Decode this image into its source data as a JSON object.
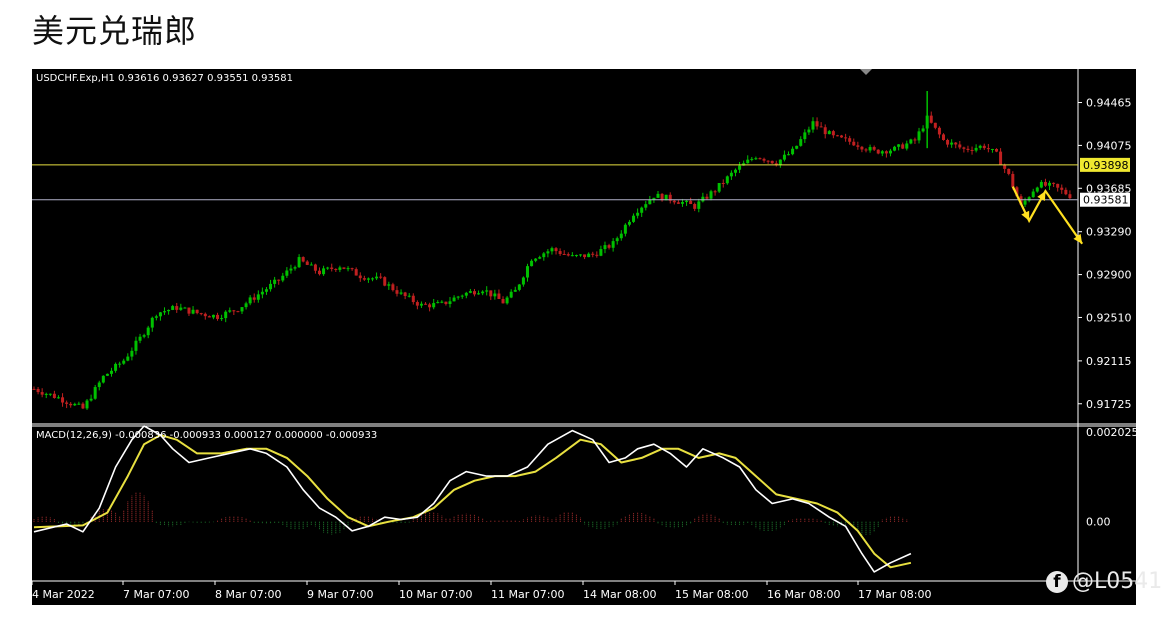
{
  "page_title": "美元兑瑞郎",
  "colors": {
    "background": "#000000",
    "bull_candle": "#00c000",
    "bear_candle": "#c02020",
    "macd_line": "#ffffff",
    "signal_line": "#e8e040",
    "hist_pos": "#b03030",
    "hist_neg": "#208030",
    "horizontal_line_1": "#e8e040",
    "horizontal_line_2": "#b0b0c8",
    "arrow": "#ffe020"
  },
  "watermark": {
    "icon": "facebook-icon",
    "text": "@L0541"
  },
  "chart_data": {
    "type": "candlestick",
    "symbol_header": "USDCHF.Exp,H1  0.93616 0.93627 0.93551 0.93581",
    "price_axis": {
      "ticks": [
        "0.94465",
        "0.94075",
        "0.93685",
        "0.93290",
        "0.92900",
        "0.92510",
        "0.92115",
        "0.91725"
      ],
      "ylim": [
        0.9155,
        0.9477
      ]
    },
    "price_labels": [
      {
        "label": "0.93898",
        "value": 0.93898,
        "style": "yellow"
      },
      {
        "label": "0.93581",
        "value": 0.93581,
        "style": "white"
      }
    ],
    "x_labels": [
      "4 Mar 2022",
      "7 Mar 07:00",
      "8 Mar 07:00",
      "9 Mar 07:00",
      "10 Mar 07:00",
      "11 Mar 07:00",
      "14 Mar 08:00",
      "15 Mar 08:00",
      "16 Mar 08:00",
      "17 Mar 08:00"
    ],
    "close_path": [
      [
        0,
        0.9186
      ],
      [
        6,
        0.9178
      ],
      [
        12,
        0.9168
      ],
      [
        17,
        0.9197
      ],
      [
        22,
        0.9212
      ],
      [
        26,
        0.9232
      ],
      [
        30,
        0.9255
      ],
      [
        35,
        0.926
      ],
      [
        40,
        0.9255
      ],
      [
        45,
        0.9252
      ],
      [
        50,
        0.9259
      ],
      [
        55,
        0.9272
      ],
      [
        60,
        0.9285
      ],
      [
        65,
        0.9303
      ],
      [
        70,
        0.9292
      ],
      [
        75,
        0.9298
      ],
      [
        80,
        0.9289
      ],
      [
        85,
        0.9285
      ],
      [
        90,
        0.9272
      ],
      [
        95,
        0.9262
      ],
      [
        100,
        0.9263
      ],
      [
        105,
        0.9272
      ],
      [
        110,
        0.9277
      ],
      [
        115,
        0.9265
      ],
      [
        118,
        0.9275
      ],
      [
        122,
        0.9305
      ],
      [
        127,
        0.9313
      ],
      [
        132,
        0.9306
      ],
      [
        137,
        0.9308
      ],
      [
        142,
        0.9318
      ],
      [
        147,
        0.9346
      ],
      [
        152,
        0.9362
      ],
      [
        157,
        0.9358
      ],
      [
        162,
        0.9352
      ],
      [
        167,
        0.9367
      ],
      [
        172,
        0.9385
      ],
      [
        177,
        0.9398
      ],
      [
        182,
        0.9392
      ],
      [
        186,
        0.9402
      ],
      [
        191,
        0.9428
      ],
      [
        196,
        0.9415
      ],
      [
        201,
        0.941
      ],
      [
        206,
        0.9402
      ],
      [
        211,
        0.9404
      ],
      [
        216,
        0.9412
      ],
      [
        219,
        0.9432
      ],
      [
        223,
        0.9412
      ],
      [
        228,
        0.9404
      ],
      [
        233,
        0.9407
      ],
      [
        236,
        0.9399
      ],
      [
        239,
        0.938
      ],
      [
        242,
        0.9352
      ],
      [
        246,
        0.9372
      ],
      [
        250,
        0.937
      ],
      [
        254,
        0.9362
      ]
    ],
    "macd_header": "MACD(12,26,9) -0.000836 -0.000933 0.000127 0.000000 -0.000933",
    "macd_axis": {
      "ticks": [
        "0.002025",
        "0.00"
      ],
      "ylim": [
        -0.0013,
        0.0021
      ]
    },
    "macd_line": [
      [
        0,
        -0.00022
      ],
      [
        8,
        -5e-05
      ],
      [
        12,
        -0.00022
      ],
      [
        16,
        0.0003
      ],
      [
        20,
        0.0012
      ],
      [
        24,
        0.0018
      ],
      [
        27,
        0.0021
      ],
      [
        31,
        0.0019
      ],
      [
        34,
        0.0016
      ],
      [
        38,
        0.0013
      ],
      [
        43,
        0.0014
      ],
      [
        48,
        0.0015
      ],
      [
        53,
        0.0016
      ],
      [
        57,
        0.0015
      ],
      [
        62,
        0.0012
      ],
      [
        66,
        0.0007
      ],
      [
        70,
        0.0003
      ],
      [
        74,
        0.0001
      ],
      [
        78,
        -0.0002
      ],
      [
        82,
        -0.0001
      ],
      [
        86,
        0.0001
      ],
      [
        90,
        5e-05
      ],
      [
        94,
        0.0001
      ],
      [
        98,
        0.0004
      ],
      [
        102,
        0.0009
      ],
      [
        106,
        0.0011
      ],
      [
        111,
        0.001
      ],
      [
        116,
        0.001
      ],
      [
        121,
        0.0012
      ],
      [
        126,
        0.0017
      ],
      [
        132,
        0.002
      ],
      [
        137,
        0.0018
      ],
      [
        141,
        0.0013
      ],
      [
        145,
        0.0014
      ],
      [
        148,
        0.0016
      ],
      [
        152,
        0.0017
      ],
      [
        156,
        0.0015
      ],
      [
        160,
        0.0012
      ],
      [
        164,
        0.0016
      ],
      [
        169,
        0.0014
      ],
      [
        173,
        0.0012
      ],
      [
        177,
        0.0007
      ],
      [
        181,
        0.0004
      ],
      [
        186,
        0.0005
      ],
      [
        190,
        0.0004
      ],
      [
        195,
        0.0001
      ],
      [
        199,
        -0.0001
      ],
      [
        203,
        -0.0007
      ],
      [
        206,
        -0.0011
      ],
      [
        210,
        -0.0009
      ],
      [
        215,
        -0.0007
      ]
    ],
    "signal_line": [
      [
        0,
        -0.00012
      ],
      [
        12,
        -8e-05
      ],
      [
        18,
        0.0002
      ],
      [
        23,
        0.001
      ],
      [
        27,
        0.0017
      ],
      [
        31,
        0.0019
      ],
      [
        35,
        0.0018
      ],
      [
        40,
        0.0015
      ],
      [
        46,
        0.0015
      ],
      [
        52,
        0.0016
      ],
      [
        57,
        0.0016
      ],
      [
        62,
        0.0014
      ],
      [
        67,
        0.001
      ],
      [
        72,
        0.0005
      ],
      [
        77,
        0.0001
      ],
      [
        82,
        -0.0001
      ],
      [
        87,
        0.0
      ],
      [
        93,
        0.0001
      ],
      [
        98,
        0.0003
      ],
      [
        103,
        0.0007
      ],
      [
        108,
        0.0009
      ],
      [
        113,
        0.001
      ],
      [
        118,
        0.001
      ],
      [
        123,
        0.0011
      ],
      [
        128,
        0.0014
      ],
      [
        134,
        0.0018
      ],
      [
        139,
        0.0017
      ],
      [
        144,
        0.0013
      ],
      [
        149,
        0.0014
      ],
      [
        154,
        0.0016
      ],
      [
        158,
        0.0016
      ],
      [
        163,
        0.0014
      ],
      [
        168,
        0.0015
      ],
      [
        172,
        0.0014
      ],
      [
        177,
        0.001
      ],
      [
        182,
        0.0006
      ],
      [
        187,
        0.0005
      ],
      [
        192,
        0.0004
      ],
      [
        197,
        0.0002
      ],
      [
        202,
        -0.0002
      ],
      [
        206,
        -0.0007
      ],
      [
        210,
        -0.001
      ],
      [
        215,
        -0.0009
      ]
    ],
    "histogram_segments": [
      [
        0,
        5,
        0.00012
      ],
      [
        6,
        13,
        -8e-05
      ],
      [
        14,
        21,
        0.00028
      ],
      [
        22,
        29,
        0.00065
      ],
      [
        30,
        37,
        -0.0001
      ],
      [
        38,
        44,
        -2e-05
      ],
      [
        45,
        53,
        0.00012
      ],
      [
        54,
        60,
        -5e-05
      ],
      [
        61,
        68,
        -0.00018
      ],
      [
        69,
        77,
        -0.00028
      ],
      [
        78,
        84,
        0.00012
      ],
      [
        85,
        92,
        -4e-05
      ],
      [
        93,
        101,
        0.00022
      ],
      [
        102,
        110,
        0.00018
      ],
      [
        111,
        119,
        4e-05
      ],
      [
        120,
        127,
        0.00014
      ],
      [
        128,
        134,
        0.00022
      ],
      [
        135,
        143,
        -0.00016
      ],
      [
        144,
        152,
        0.0002
      ],
      [
        153,
        161,
        -0.00014
      ],
      [
        162,
        168,
        0.00018
      ],
      [
        169,
        175,
        -8e-05
      ],
      [
        176,
        184,
        -0.00022
      ],
      [
        185,
        193,
        8e-05
      ],
      [
        194,
        200,
        -0.0001
      ],
      [
        201,
        207,
        -0.0003
      ],
      [
        208,
        214,
        0.00012
      ]
    ],
    "annotation_arrow_points": [
      [
        0.937,
        0.9357
      ],
      [
        0.9339,
        0.9366
      ],
      [
        0.9362,
        0.9318
      ]
    ]
  }
}
